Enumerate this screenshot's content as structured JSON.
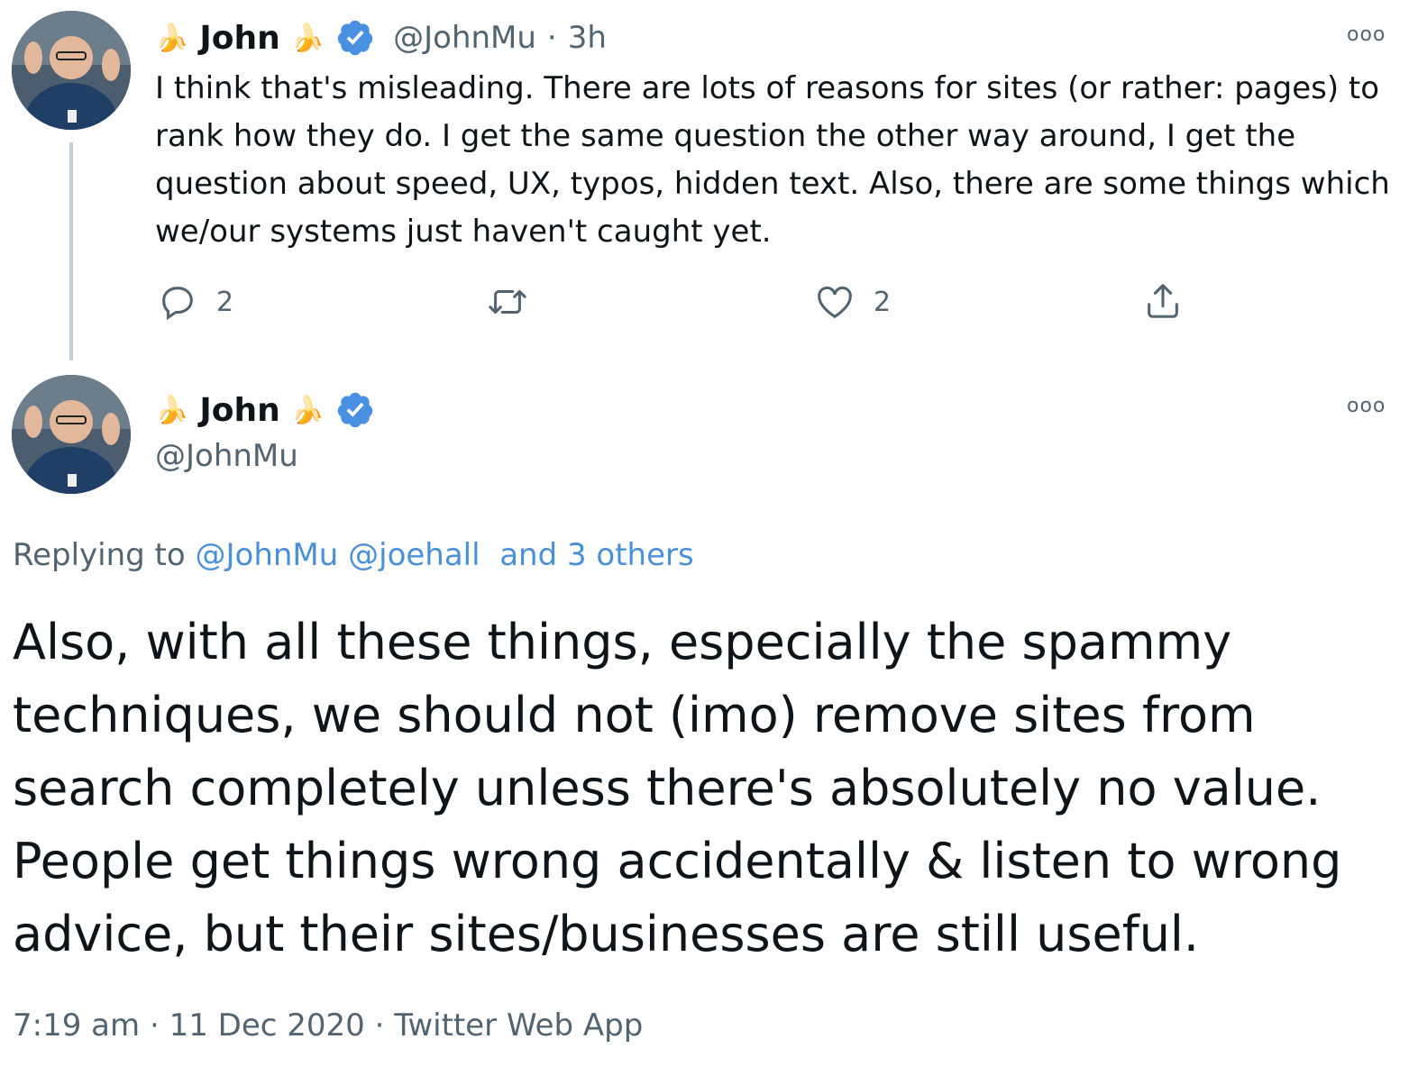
{
  "tweet1": {
    "name": "John",
    "name_emoji": "🍌",
    "handle": "@JohnMu",
    "time": "3h",
    "text": "I think that's misleading. There are lots of reasons for sites (or rather: pages) to rank how they do. I get the same question the other way around, I get the question about speed, UX, typos, hidden text. Also, there are some things which we/our systems just haven't caught yet.",
    "reply_count": "2",
    "like_count": "2",
    "more_label": "ooo"
  },
  "tweet2": {
    "name": "John",
    "name_emoji": "🍌",
    "handle": "@JohnMu",
    "more_label": "ooo",
    "replying_prefix": "Replying to",
    "replying_users": [
      "@JohnMu",
      "@joehall"
    ],
    "replying_others": "and 3 others",
    "text": "Also, with all these things, especially the spammy techniques, we should not (imo) remove sites from search completely unless there's absolutely no value. People get things wrong accidentally & listen to wrong advice, but their sites/businesses are still useful.",
    "time": "7:19 am",
    "date": "11 Dec 2020",
    "source": "Twitter Web App",
    "separator": "·"
  },
  "colors": {
    "verified": "#4a90e2",
    "link": "#4a90d9",
    "muted": "#536471",
    "thread_line": "#c4cfd6"
  },
  "icons": [
    "reply-icon",
    "retweet-icon",
    "like-icon",
    "share-icon",
    "verified-icon",
    "more-icon",
    "banana-emoji"
  ]
}
